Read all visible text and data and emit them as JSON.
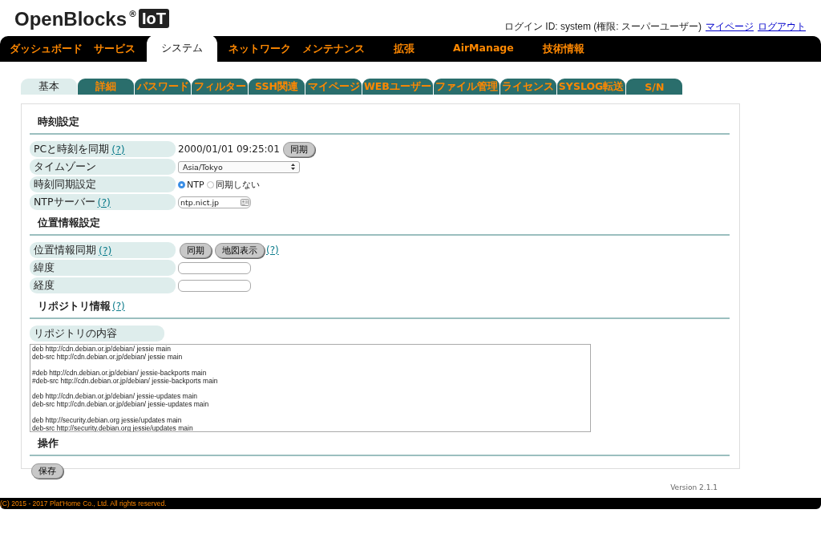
{
  "header": {
    "logo": {
      "name": "OpenBlocks",
      "mark": "®",
      "badge": "IoT"
    },
    "login_info": "ログイン ID: system (権限: スーパーユーザー)",
    "links": [
      "マイページ",
      "ログアウト"
    ]
  },
  "main_nav": [
    {
      "label": "ダッシュボード",
      "selected": false
    },
    {
      "label": "サービス",
      "selected": false
    },
    {
      "label": "システム",
      "selected": true
    },
    {
      "label": "ネットワーク",
      "selected": false
    },
    {
      "label": "メンテナンス",
      "selected": false
    },
    {
      "label": "拡張",
      "selected": false
    },
    {
      "label": "AirManage",
      "selected": false
    },
    {
      "label": "技術情報",
      "selected": false
    }
  ],
  "sub_tabs": [
    {
      "label": "基本",
      "selected": true
    },
    {
      "label": "詳細",
      "selected": false
    },
    {
      "label": "パスワード",
      "selected": false
    },
    {
      "label": "フィルター",
      "selected": false
    },
    {
      "label": "SSH関連",
      "selected": false
    },
    {
      "label": "マイページ",
      "selected": false
    },
    {
      "label": "WEBユーザー",
      "selected": false
    },
    {
      "label": "ファイル管理",
      "selected": false
    },
    {
      "label": "ライセンス",
      "selected": false
    },
    {
      "label": "SYSLOG転送",
      "selected": false
    },
    {
      "label": "S/N",
      "selected": false
    }
  ],
  "sections": [
    {
      "title": "時刻設定",
      "rows": [
        {
          "kind": "text_button",
          "label": "PCと時刻を同期",
          "help": "(?)",
          "value": "2000/01/01 09:25:01",
          "buttons": [
            "同期"
          ]
        },
        {
          "kind": "select",
          "label": "タイムゾーン",
          "value": "Asia/Tokyo"
        },
        {
          "kind": "radio",
          "label": "時刻同期設定",
          "options": [
            {
              "label": "NTP",
              "selected": true
            },
            {
              "label": "同期しない",
              "selected": false
            }
          ]
        },
        {
          "kind": "input",
          "label": "NTPサーバー",
          "help": "(?)",
          "value": "ntp.nict.jp",
          "contact_icon": true
        }
      ]
    },
    {
      "title": "位置情報設定",
      "rows": [
        {
          "kind": "buttons",
          "label": "位置情報同期",
          "help": "(?)",
          "buttons": [
            "同期",
            "地図表示"
          ],
          "after_help": "(?)"
        },
        {
          "kind": "input",
          "label": "緯度"
        },
        {
          "kind": "input",
          "label": "経度"
        }
      ]
    },
    {
      "title": "リポジトリ情報",
      "help": "(?)",
      "rows": [
        {
          "kind": "textarea",
          "label": "リポジトリの内容",
          "value": "deb http://cdn.debian.or.jp/debian/ jessie main\ndeb-src http://cdn.debian.or.jp/debian/ jessie main\n\n#deb http://cdn.debian.or.jp/debian/ jessie-backports main\n#deb-src http://cdn.debian.or.jp/debian/ jessie-backports main\n\ndeb http://cdn.debian.or.jp/debian/ jessie-updates main\ndeb-src http://cdn.debian.or.jp/debian/ jessie-updates main\n\ndeb http://security.debian.org jessie/updates main\ndeb-src http://security.debian.org jessie/updates main"
        }
      ]
    },
    {
      "title": "操作",
      "rows": [
        {
          "kind": "actions",
          "buttons": [
            "保存"
          ]
        }
      ]
    }
  ],
  "version": "Version 2.1.1",
  "footer": "(C) 2015 - 2017 Plat'Home Co., Ltd. All rights reserved."
}
